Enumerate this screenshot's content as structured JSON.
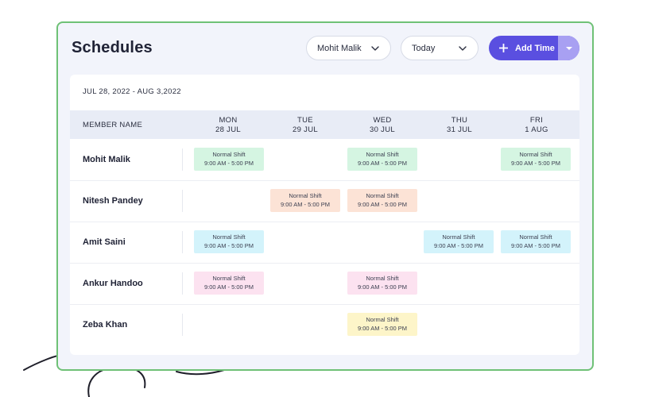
{
  "header": {
    "title": "Schedules",
    "member_select": "Mohit Malik",
    "date_select": "Today",
    "add_button": "Add Time"
  },
  "date_range": "JUL 28, 2022 - AUG 3,2022",
  "table": {
    "member_col": "MEMBER NAME",
    "days": [
      {
        "day": "MON",
        "date": "28 JUL"
      },
      {
        "day": "TUE",
        "date": "29 JUL"
      },
      {
        "day": "WED",
        "date": "30 JUL"
      },
      {
        "day": "THU",
        "date": "31 JUL"
      },
      {
        "day": "FRI",
        "date": "1 AUG"
      }
    ],
    "rows": [
      {
        "name": "Mohit Malik"
      },
      {
        "name": "Nitesh Pandey"
      },
      {
        "name": "Amit Saini"
      },
      {
        "name": "Ankur Handoo"
      },
      {
        "name": "Zeba Khan"
      }
    ]
  },
  "shift": {
    "label": "Normal Shift",
    "time": "9:00 AM - 5:00 PM"
  },
  "colors": {
    "accent": "#5a4fe0",
    "border": "#6fc176",
    "green": "#d5f5e2",
    "peach": "#fce3d6",
    "cyan": "#d3f3fb",
    "pink": "#fce2f0",
    "yellow": "#fdf5c9"
  }
}
